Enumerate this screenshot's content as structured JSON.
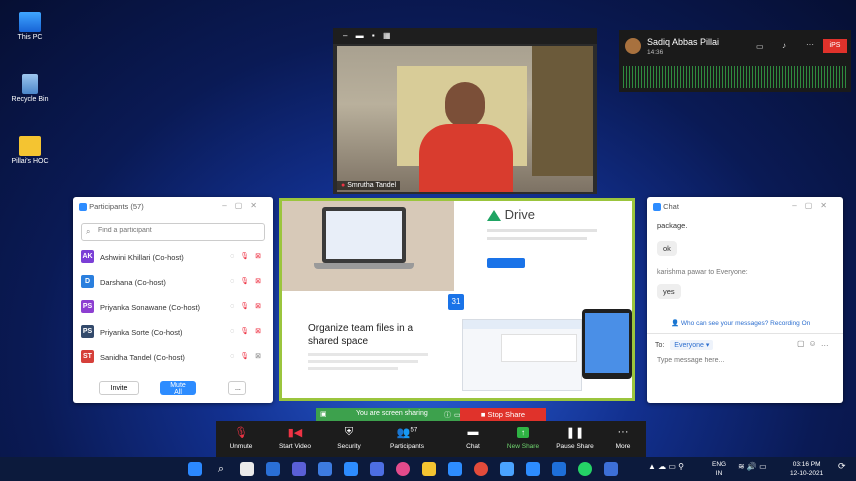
{
  "desktop": {
    "icons": [
      {
        "label": "This PC"
      },
      {
        "label": "Recycle Bin"
      },
      {
        "label": "Pillai's HOC"
      }
    ]
  },
  "video": {
    "participant_name": "Smrutha Tandel"
  },
  "speaker": {
    "name": "Sadiq Abbas Pillai",
    "duration": "14:36",
    "badge": "iPS"
  },
  "participants": {
    "title": "Participants (57)",
    "search_placeholder": "Find a participant",
    "items": [
      {
        "initials": "AK",
        "name": "Ashwini Khillari (Co-host)",
        "color": "#7b3fd6"
      },
      {
        "initials": "D",
        "name": "Darshana (Co-host)",
        "color": "#2a7fde"
      },
      {
        "initials": "PS",
        "name": "Priyanka Sonawane (Co-host)",
        "color": "#8d3fd1"
      },
      {
        "initials": "PS",
        "name": "Priyanka Sorte (Co-host)",
        "color": "#334a6b"
      },
      {
        "initials": "ST",
        "name": "Sanidha Tandel (Co-host)",
        "color": "#d6403a"
      }
    ],
    "invite_label": "Invite",
    "mute_all_label": "Mute All",
    "more_label": "..."
  },
  "share": {
    "product": "Drive",
    "headline": "Organize team files in a shared space",
    "calendar_day": "31"
  },
  "chat": {
    "title": "Chat",
    "messages": [
      {
        "text": "package.",
        "type": "msg"
      },
      {
        "text": "ok",
        "type": "bubble"
      },
      {
        "text": "karishma pawar to Everyone:",
        "type": "sender"
      },
      {
        "text": "yes",
        "type": "bubble"
      }
    ],
    "privacy_note": "Who can see your messages? Recording On",
    "to_label": "To:",
    "recipient": "Everyone",
    "input_placeholder": "Type message here..."
  },
  "sharing_bar": {
    "status": "You are screen sharing",
    "stop_label": "Stop Share"
  },
  "toolbar": {
    "items": [
      {
        "label": "Unmute",
        "icon": "mic-muted-icon"
      },
      {
        "label": "Start Video",
        "icon": "video-off-icon"
      },
      {
        "label": "Security",
        "icon": "shield-icon"
      },
      {
        "label": "Participants",
        "icon": "participants-icon",
        "badge": "57"
      },
      {
        "label": "Chat",
        "icon": "chat-icon"
      },
      {
        "label": "New Share",
        "icon": "share-icon"
      },
      {
        "label": "Pause Share",
        "icon": "pause-icon"
      },
      {
        "label": "More",
        "icon": "more-icon"
      }
    ]
  },
  "taskbar": {
    "lang": "ENG",
    "region": "IN",
    "time": "03:16 PM",
    "date": "12-10-2021"
  }
}
